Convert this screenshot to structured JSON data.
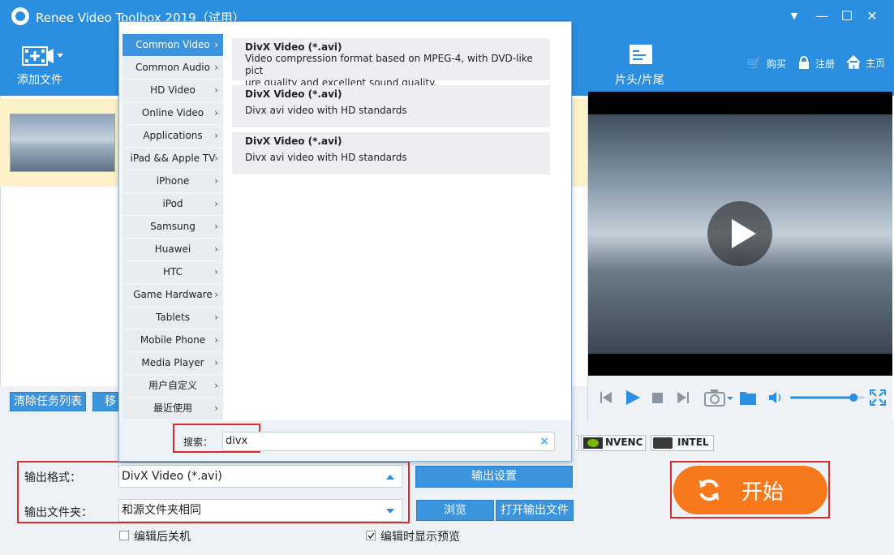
{
  "window": {
    "title": "Renee Video Toolbox 2019（试用）",
    "min": "▼",
    "minimize": "—",
    "maximize": "☐",
    "close": "✕"
  },
  "toolbar": {
    "add_file": "添加文件",
    "intro_outro": "片头/片尾",
    "buy": "购买",
    "register": "注册",
    "home": "主页"
  },
  "list": {
    "clear_label": "清除任务列表",
    "move_label": "移"
  },
  "categories": [
    "Common Video",
    "Common Audio",
    "HD Video",
    "Online Video",
    "Applications",
    "iPad && Apple TV",
    "iPhone",
    "iPod",
    "Samsung",
    "Huawei",
    "HTC",
    "Game Hardware",
    "Tablets",
    "Mobile Phone",
    "Media Player",
    "用户自定义",
    "最近使用"
  ],
  "formats": [
    {
      "title": "DivX Video (*.avi)",
      "desc1": "Video compression format based on MPEG-4, with DVD-like pict",
      "desc2": "ure quality and excellent sound quality."
    },
    {
      "title": "DivX Video (*.avi)",
      "desc1": "Divx avi video with HD standards",
      "desc2": ""
    },
    {
      "title": "DivX Video (*.avi)",
      "desc1": "Divx avi video with HD standards",
      "desc2": ""
    }
  ],
  "search": {
    "label": "搜索：",
    "value": "divx",
    "clear": "×"
  },
  "gpu": {
    "nvenc": "NVENC",
    "intel": "INTEL"
  },
  "output": {
    "format_label": "输出格式：",
    "format_value": "DivX Video (*.avi)",
    "folder_label": "输出文件夹：",
    "folder_value": "和源文件夹相同",
    "settings_btn": "输出设置",
    "browse_btn": "浏览",
    "open_btn": "打开输出文件",
    "shutdown_label": "编辑后关机",
    "preview_label": "编辑时显示预览"
  },
  "start_btn": "开始",
  "colors": {
    "accent": "#2a8fe0",
    "start": "#f7791b",
    "highlight": "#d92c2c"
  },
  "player": {
    "volume": 0.85
  }
}
